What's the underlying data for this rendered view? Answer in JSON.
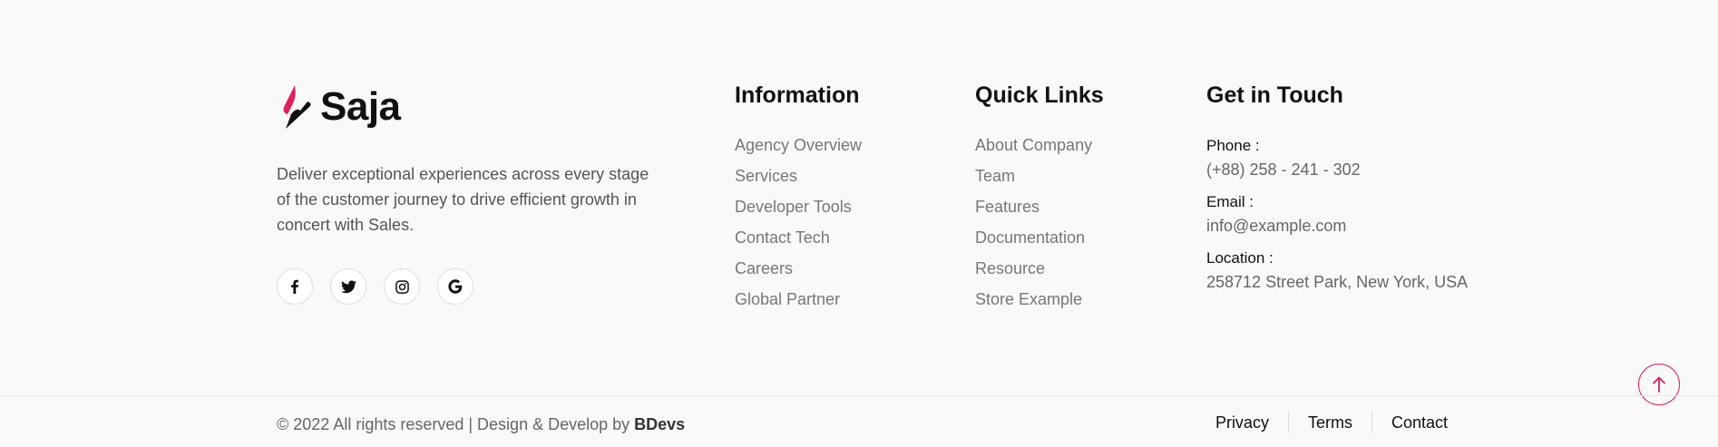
{
  "brand": {
    "name": "Saja",
    "description": "Deliver exceptional experiences across every stage of the customer journey to drive efficient growth in concert with Sales.",
    "accent_color": "#e01e5a",
    "socials": [
      {
        "icon": "facebook-icon"
      },
      {
        "icon": "twitter-icon"
      },
      {
        "icon": "instagram-icon"
      },
      {
        "icon": "google-icon"
      }
    ]
  },
  "information": {
    "title": "Information",
    "links": [
      "Agency Overview",
      "Services",
      "Developer Tools",
      "Contact Tech",
      "Careers",
      "Global Partner"
    ]
  },
  "quick_links": {
    "title": "Quick Links",
    "links": [
      "About Company",
      "Team",
      "Features",
      "Documentation",
      "Resource",
      "Store Example"
    ]
  },
  "get_in_touch": {
    "title": "Get in Touch",
    "phone_label": "Phone :",
    "phone": "(+88) 258 - 241 - 302",
    "email_label": "Email :",
    "email": "info@example.com",
    "location_label": "Location :",
    "location": "258712 Street Park, New York, USA"
  },
  "bottom": {
    "copyright_prefix": "© 2022 All rights reserved | Design & Develop by ",
    "copyright_brand": "BDevs",
    "links": [
      "Privacy",
      "Terms",
      "Contact"
    ]
  },
  "scroll_top": {
    "icon": "arrow-up-icon"
  }
}
